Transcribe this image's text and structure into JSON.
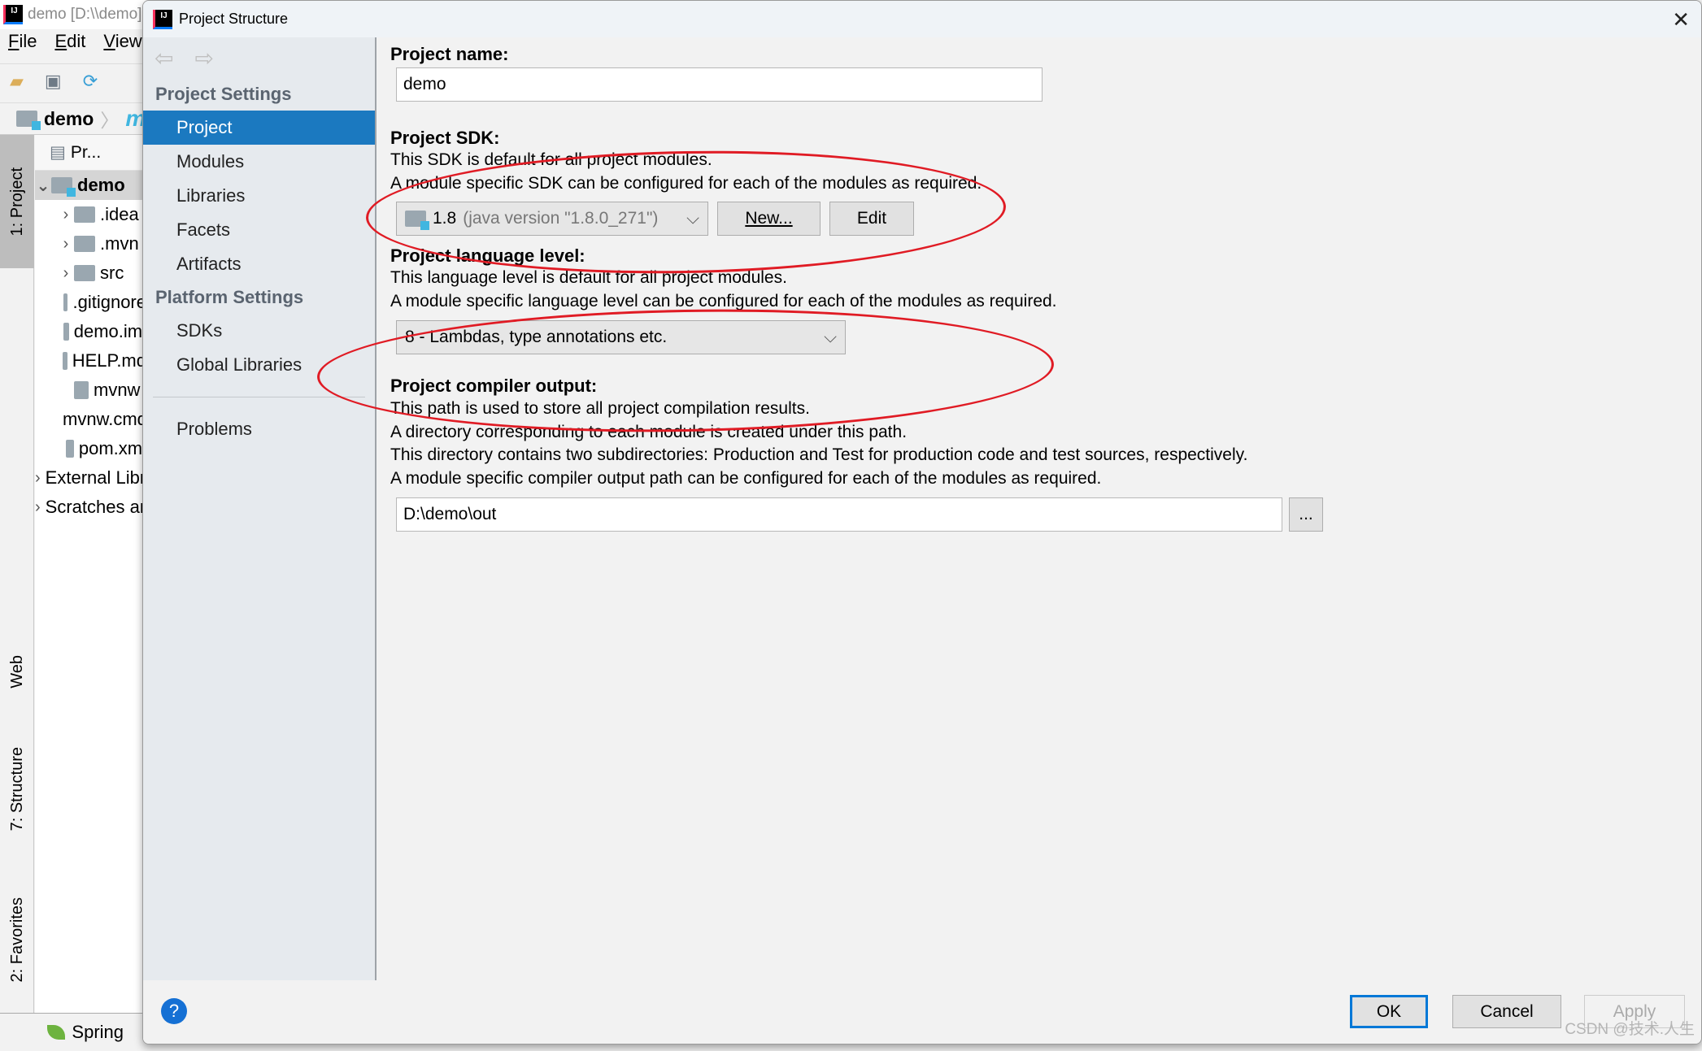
{
  "ide": {
    "window_title": "demo [D:\\\\demo]",
    "menu": [
      {
        "label": "File",
        "mnemonic": "F",
        "rest": "ile"
      },
      {
        "label": "Edit",
        "mnemonic": "E",
        "rest": "dit"
      },
      {
        "label": "View",
        "mnemonic": "V",
        "rest": "iew"
      }
    ],
    "breadcrumb": {
      "project": "demo"
    },
    "project_view_label": "Pr...",
    "tree": [
      {
        "label": "demo",
        "expanded": true,
        "selected": true
      },
      {
        "label": ".idea",
        "expandable": true
      },
      {
        "label": ".mvn",
        "expandable": true
      },
      {
        "label": "src",
        "expandable": true
      },
      {
        "label": ".gitignore"
      },
      {
        "label": "demo.iml"
      },
      {
        "label": "HELP.md"
      },
      {
        "label": "mvnw"
      },
      {
        "label": "mvnw.cmd"
      },
      {
        "label": "pom.xml"
      },
      {
        "label": "External Libraries",
        "expandable": true
      },
      {
        "label": "Scratches and Consoles",
        "expandable": true
      }
    ],
    "tool_stripe": {
      "project": "1: Project",
      "web": "Web",
      "structure": "7: Structure",
      "favorites": "2: Favorites"
    },
    "status": {
      "spring": "Spring"
    }
  },
  "dialog": {
    "title": "Project Structure",
    "sidebar": {
      "project_settings_header": "Project Settings",
      "project_items": [
        "Project",
        "Modules",
        "Libraries",
        "Facets",
        "Artifacts"
      ],
      "platform_settings_header": "Platform Settings",
      "platform_items": [
        "SDKs",
        "Global Libraries"
      ],
      "problems": "Problems",
      "active": "Project"
    },
    "project_name": {
      "label": "Project name:",
      "value": "demo"
    },
    "sdk": {
      "label": "Project SDK:",
      "line1": "This SDK is default for all project modules.",
      "line2": "A module specific SDK can be configured for each of the modules as required.",
      "selected_version": "1.8",
      "selected_detail": "(java version \"1.8.0_271\")",
      "new_button": "New...",
      "edit_button": "Edit"
    },
    "language_level": {
      "label": "Project language level:",
      "line1": "This language level is default for all project modules.",
      "line2": "A module specific language level can be configured for each of the modules as required.",
      "selected": "8 - Lambdas, type annotations etc."
    },
    "compiler_output": {
      "label": "Project compiler output:",
      "lines": [
        "This path is used to store all project compilation results.",
        "A directory corresponding to each module is created under this path.",
        "This directory contains two subdirectories: Production and Test for production code and test sources, respectively.",
        "A module specific compiler output path can be configured for each of the modules as required."
      ],
      "value": "D:\\demo\\out",
      "browse_button": "..."
    },
    "buttons": {
      "ok": "OK",
      "cancel": "Cancel",
      "apply": "Apply"
    },
    "watermark": "CSDN @技术.人生"
  }
}
